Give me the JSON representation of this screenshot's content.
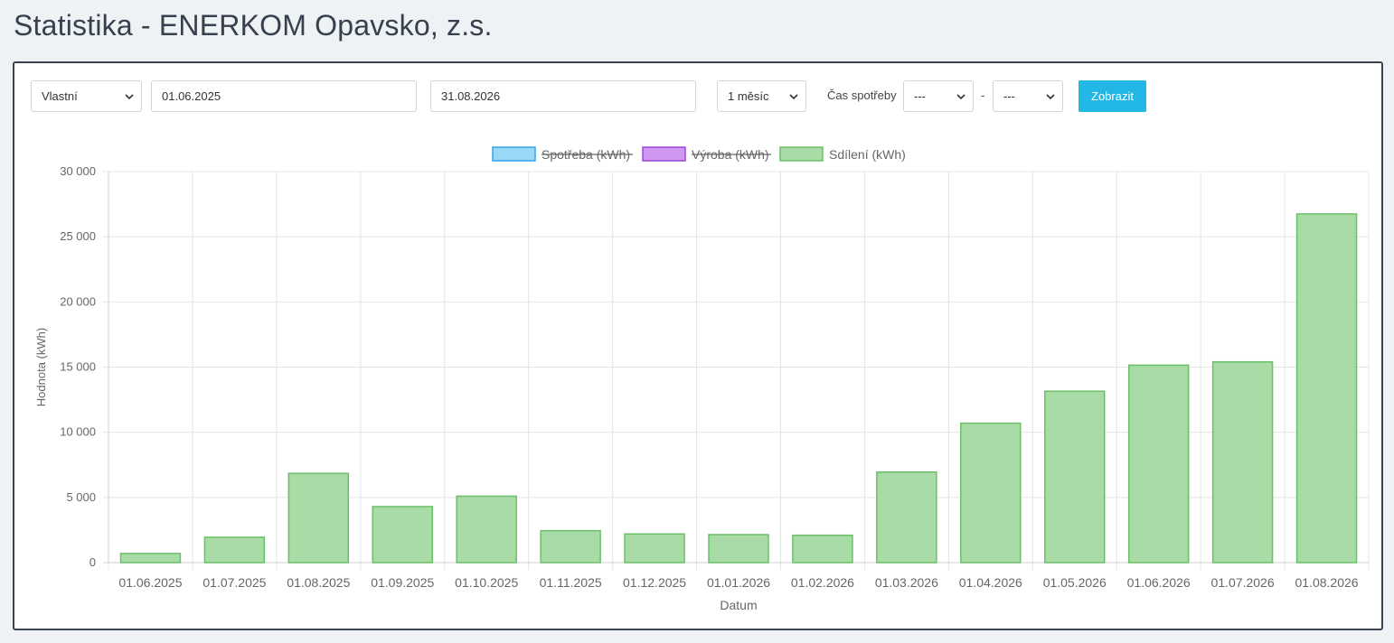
{
  "page": {
    "title": "Statistika - ENERKOM Opavsko, z.s."
  },
  "filters": {
    "period_type": "Vlastní",
    "date_from": "01.06.2025",
    "date_to": "31.08.2026",
    "interval": "1 měsíc",
    "time_label": "Čas spotřeby",
    "time_from": "---",
    "separator": "-",
    "time_to": "---",
    "show_button": "Zobrazit"
  },
  "colors": {
    "spotreba_fill": "#9ad9f6",
    "spotreba_border": "#36a2eb",
    "vyroba_fill": "#cf97f2",
    "vyroba_border": "#9b47dd",
    "sdileni_fill": "#a8dba5",
    "sdileni_border": "#6cbf6a"
  },
  "chart_data": {
    "type": "bar",
    "xlabel": "Datum",
    "ylabel": "Hodnota (kWh)",
    "ylim": [
      0,
      30000
    ],
    "yticks": [
      "0",
      "5 000",
      "10 000",
      "15 000",
      "20 000",
      "25 000",
      "30 000"
    ],
    "grid": true,
    "legend_position": "top-center",
    "categories": [
      "01.06.2025",
      "01.07.2025",
      "01.08.2025",
      "01.09.2025",
      "01.10.2025",
      "01.11.2025",
      "01.12.2025",
      "01.01.2026",
      "01.02.2026",
      "01.03.2026",
      "01.04.2026",
      "01.05.2026",
      "01.06.2026",
      "01.07.2026",
      "01.08.2026"
    ],
    "series": [
      {
        "name": "Spotřeba (kWh)",
        "hidden": true,
        "values": []
      },
      {
        "name": "Výroba (kWh)",
        "hidden": true,
        "values": []
      },
      {
        "name": "Sdílení (kWh)",
        "hidden": false,
        "values": [
          700,
          1950,
          6850,
          4300,
          5100,
          2450,
          2200,
          2150,
          2100,
          6950,
          10700,
          13150,
          15150,
          15400,
          26750
        ]
      }
    ]
  }
}
